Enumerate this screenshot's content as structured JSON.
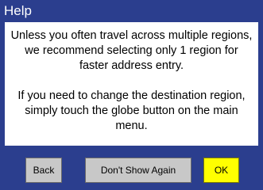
{
  "dialog": {
    "title": "Help",
    "paragraph1": "Unless you often travel across multiple regions, we recommend selecting only 1 region for faster address entry.",
    "paragraph2": "If you need to change the destination region, simply touch the globe button on the main menu."
  },
  "buttons": {
    "back": "Back",
    "dont_show_again": "Don't Show Again",
    "ok": "OK"
  },
  "colors": {
    "background": "#2b3e8e",
    "ok_button": "#ffff00",
    "button": "#c8c8c8"
  }
}
